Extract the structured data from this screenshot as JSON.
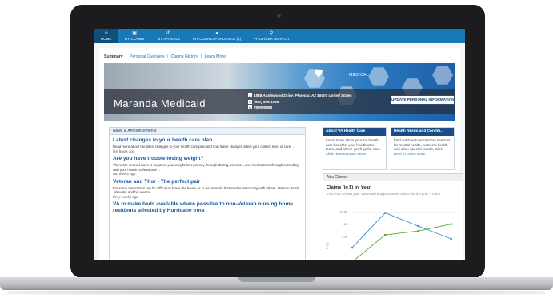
{
  "nav": {
    "items": [
      {
        "label": "HOME",
        "icon": "☺",
        "active": true
      },
      {
        "label": "MY CLAIMS",
        "icon": "▣"
      },
      {
        "label": "MY APPEALS",
        "icon": "✆"
      },
      {
        "label": "MY CORRESPONDENCE (1)",
        "icon": "●"
      },
      {
        "label": "PROVIDER SEARCH",
        "icon": "⚲"
      }
    ]
  },
  "breadcrumb": {
    "current": "Summary",
    "sep": "|",
    "links": [
      "Personal Overview",
      "Claims History",
      "Learn More"
    ]
  },
  "hero": {
    "medical_tag": "MEDICAL",
    "name": "Maranda  Medicaid",
    "address": "1888 Applewood Drive; Phoenix, AZ 85007 United States",
    "phone": "(602) 506-1888",
    "id_number": "789089888",
    "update_button": "UPDATE PERSONAL INFORMATION"
  },
  "news": {
    "heading": "News & Announcements",
    "more": "...",
    "items": [
      {
        "title": "Latest changes to your health care plan...",
        "body": "Read more about the latest changes to your health care plan and how these changes affect your current level of care.",
        "time": "five hours ago"
      },
      {
        "title": "Are you have trouble losing weight?",
        "body": "There are several ways to begin on your weight-loss journey through dieting, exercise, and medications through consulting with your health professional",
        "time": "two weeks ago"
      },
      {
        "title": "Veteran and Thor - The perfect pair",
        "body": "For some Veterans it can be difficult to leave the house or to run errands that involve interacting with others. Veteran Justin Jirkovsky and his mental",
        "time": "three weeks ago"
      },
      {
        "title": "VA to make beds available where possible to non-Veteran nursing home residents affected by Hurricane Irma",
        "body": "",
        "time": ""
      }
    ]
  },
  "cards": [
    {
      "title": "About VA Health Care",
      "body": "Learn more about your VA health care benefits, your health care team, and where you'll go for care.",
      "link": "Click Here to Learn More"
    },
    {
      "title": "Health Needs and Conditi...",
      "body": "Find out how to access VA services for mental health, women's health, and other specific needs.",
      "link": "Click Here to Learn More"
    }
  ],
  "glance": {
    "heading": "At a Glance",
    "title": "Claims (in $) by Year",
    "subtitle": "This chart shows your submitted and processed claims for the prior 4 mont"
  },
  "chart_data": {
    "type": "line",
    "x": [
      1,
      2,
      3,
      4
    ],
    "ylim": [
      0,
      14000
    ],
    "yticks": [
      "12.5k",
      "10k",
      "7.5k"
    ],
    "ylabel": "$ (K)",
    "series": [
      {
        "color": "#3b8fd6",
        "values": [
          5200,
          12300,
          9600,
          7000
        ]
      },
      {
        "color": "#58a83a",
        "values": [
          2300,
          7800,
          8600,
          10000
        ]
      }
    ]
  }
}
